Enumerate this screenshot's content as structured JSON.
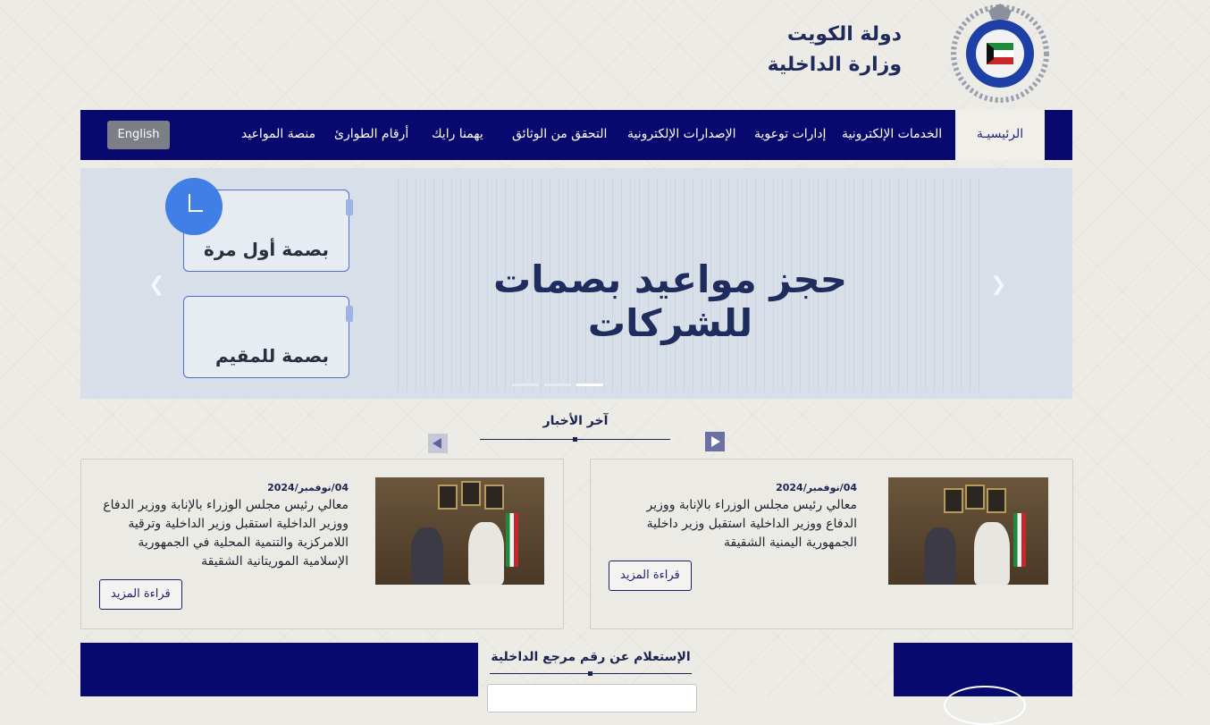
{
  "header": {
    "country": "دولة الكويت",
    "ministry": "وزارة الداخلية",
    "logo_icon": "kuwait-police-emblem"
  },
  "nav": {
    "items": [
      "الرئيسيـة",
      "الخدمات الإلكترونية",
      "إدارات توعوية",
      "الإصدارات الإلكترونية",
      "التحقق من الوثائق",
      "يهمنا رايك",
      "أرقام الطوارئ",
      "منصة المواعيد"
    ],
    "lang_button": "English"
  },
  "slider": {
    "title": "حجز مواعيد بصمات للشركات",
    "card1": "بصمة أول مرة",
    "card2": "بصمة للمقيم",
    "prev_icon": "chevron-left-icon",
    "next_icon": "chevron-right-icon",
    "active_slide": 3,
    "slide_count": 3
  },
  "news": {
    "heading": "آخر الأخبار",
    "items": [
      {
        "date": "04/نوفمبر/2024",
        "text": "معالي رئيس مجلس الوزراء بالإنابة ووزير الدفاع ووزير الداخلية استقبل وزير داخلية الجمهورية اليمنية الشقيقة",
        "more": "قراءة المزيد"
      },
      {
        "date": "04/نوفمبر/2024",
        "text": "معالي رئيس مجلس الوزراء بالإنابة ووزير الدفاع ووزير الداخلية استقبل وزير الداخلية وترقية اللامركزية والتنمية المحلية في الجمهورية الإسلامية الموريتانية الشقيقة",
        "more": "قراءة المزيد"
      }
    ]
  },
  "reference": {
    "title": "الإستعلام عن رقم مرجع الداخلية"
  },
  "colors": {
    "nav": "#07096e",
    "accent": "#3f7fe6"
  }
}
